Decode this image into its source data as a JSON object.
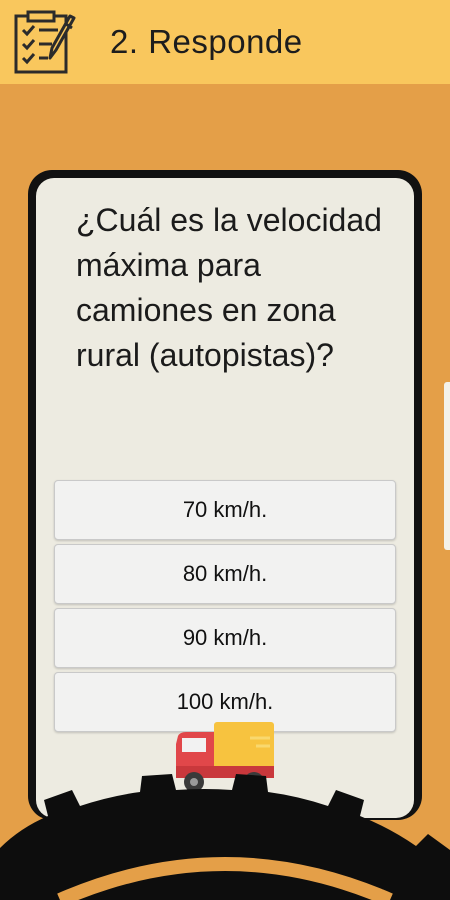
{
  "header": {
    "title": "2. Responde",
    "icon": "checklist-pencil-icon",
    "background_color": "#f9c75d"
  },
  "page": {
    "background_color": "#e49f48"
  },
  "quiz": {
    "question": "¿Cuál es la velocidad máxima para camiones en zona rural (autopistas)?",
    "options": [
      {
        "label": "70 km/h."
      },
      {
        "label": "80 km/h."
      },
      {
        "label": "90 km/h."
      },
      {
        "label": "100 km/h."
      }
    ]
  },
  "decorations": {
    "truck": "delivery-truck-icon",
    "gear": "gear-wheel-icon"
  }
}
